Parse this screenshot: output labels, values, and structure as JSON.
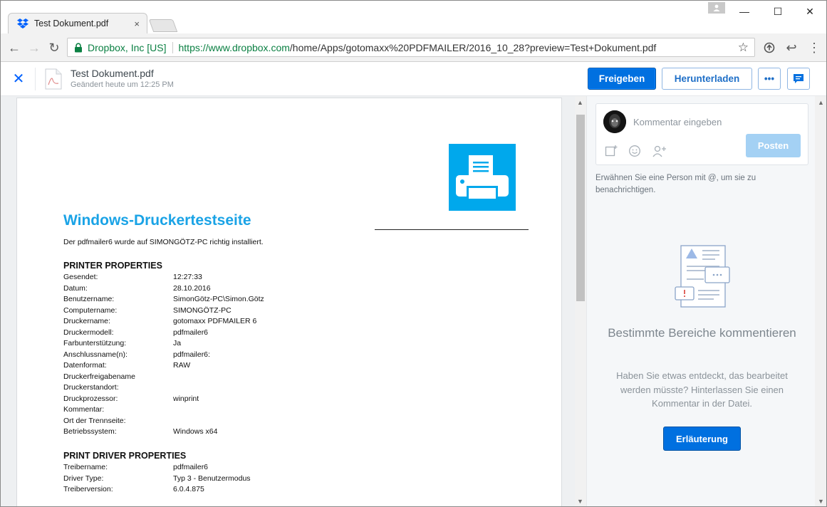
{
  "browser": {
    "tab_title": "Test Dokument.pdf",
    "tab_close": "×",
    "security_label": "Dropbox, Inc [US]",
    "url_host": "https://www.dropbox.com",
    "url_path": "/home/Apps/gotomaxx%20PDFMAILER/2016_10_28?preview=Test+Dokument.pdf",
    "window_controls": {
      "minimize": "—",
      "maximize": "☐",
      "close": "✕"
    },
    "nav": {
      "back": "←",
      "forward": "→",
      "reload": "↻",
      "star": "☆",
      "menu": "⋮",
      "reply": "↩"
    }
  },
  "header": {
    "close_icon": "✕",
    "file_name": "Test Dokument.pdf",
    "modified": "Geändert heute um 12:25 PM",
    "share_label": "Freigeben",
    "download_label": "Herunterladen",
    "more_label": "•••"
  },
  "document": {
    "title": "Windows-Druckertestseite",
    "intro": "Der pdfmailer6 wurde auf SIMONGÖTZ-PC richtig installiert.",
    "printer_section": "PRINTER PROPERTIES",
    "printer_properties": [
      {
        "key": "Gesendet:",
        "value": "12:27:33"
      },
      {
        "key": "Datum:",
        "value": "28.10.2016"
      },
      {
        "key": "Benutzername:",
        "value": "SimonGötz-PC\\Simon.Götz"
      },
      {
        "key": "Computername:",
        "value": "SIMONGÖTZ-PC"
      },
      {
        "key": "Druckername:",
        "value": "gotomaxx PDFMAILER 6"
      },
      {
        "key": "Druckermodell:",
        "value": "pdfmailer6"
      },
      {
        "key": "Farbunterstützung:",
        "value": "Ja"
      },
      {
        "key": "Anschlussname(n):",
        "value": "pdfmailer6:"
      },
      {
        "key": "Datenformat:",
        "value": "RAW"
      },
      {
        "key": "Druckerfreigabename",
        "value": ""
      },
      {
        "key": "Druckerstandort:",
        "value": ""
      },
      {
        "key": "Druckprozessor:",
        "value": "winprint"
      },
      {
        "key": "Kommentar:",
        "value": ""
      },
      {
        "key": "Ort der Trennseite:",
        "value": ""
      },
      {
        "key": "Betriebssystem:",
        "value": "Windows x64"
      }
    ],
    "driver_section": "PRINT DRIVER PROPERTIES",
    "driver_properties": [
      {
        "key": "Treibername:",
        "value": "pdfmailer6"
      },
      {
        "key": "Driver Type:",
        "value": "Typ 3 - Benutzermodus"
      },
      {
        "key": "Treiberversion:",
        "value": "6.0.4.875"
      }
    ]
  },
  "sidebar": {
    "comment_placeholder": "Kommentar eingeben",
    "post_label": "Posten",
    "mention_hint": "Erwähnen Sie eine Person mit @, um sie zu benachrichtigen.",
    "empty_title": "Bestimmte Bereiche kommentieren",
    "empty_text": "Haben Sie etwas entdeckt, das bearbeitet werden müsste? Hinterlassen Sie einen Kommentar in der Datei.",
    "explain_label": "Erläuterung"
  },
  "colors": {
    "accent": "#0070e0",
    "title_blue": "#1aa3e6",
    "printer_tile": "#00a8ec",
    "secure_green": "#0b8043"
  }
}
